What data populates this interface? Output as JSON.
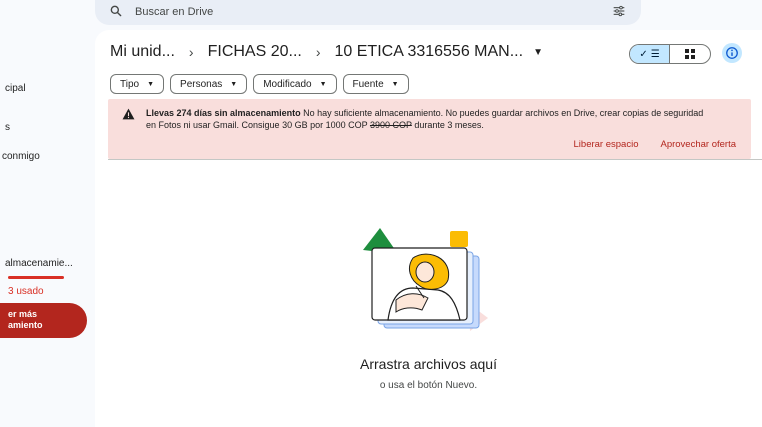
{
  "search": {
    "placeholder": "Buscar en Drive"
  },
  "sidebar": {
    "items": [
      {
        "label": "cipal"
      },
      {
        "label": "s"
      },
      {
        "label": " conmigo"
      },
      {
        "label": "almacenamie..."
      }
    ],
    "storage_used": "3 usado",
    "buy_storage_line1": "er más",
    "buy_storage_line2": "amiento"
  },
  "breadcrumb": {
    "items": [
      "Mi unid...",
      "FICHAS 20...",
      "10 ETICA 3316556 MAN..."
    ],
    "separator": "›"
  },
  "filters": [
    {
      "label": "Tipo"
    },
    {
      "label": "Personas"
    },
    {
      "label": "Modificado"
    },
    {
      "label": "Fuente"
    }
  ],
  "banner": {
    "bold": "Llevas 274 días sin almacenamiento",
    "text1": " No hay suficiente almacenamiento. No puedes guardar archivos en Drive, crear copias de seguridad en Fotos ni usar Gmail. Consigue 30 GB por 1000 COP ",
    "strike": "3900 COP",
    "text2": " durante 3 meses.",
    "action_free": "Liberar espacio",
    "action_offer": "Aprovechar oferta"
  },
  "empty_state": {
    "title": "Arrastra archivos aquí",
    "subtitle": "o usa el botón Nuevo."
  },
  "colors": {
    "banner_bg": "#f9dedc",
    "accent_red": "#b3261e",
    "toggle_active": "#c2e7ff"
  }
}
